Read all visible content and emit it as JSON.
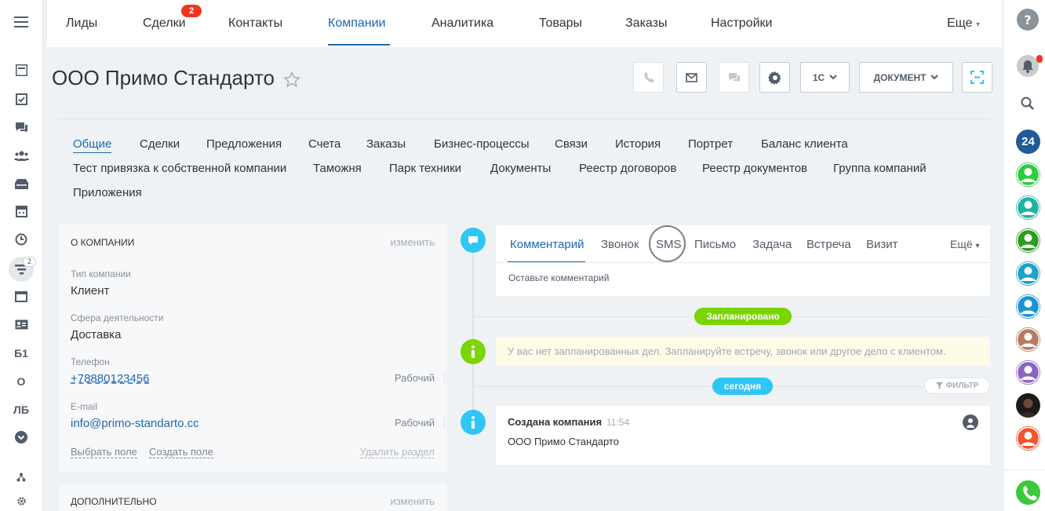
{
  "topnav": {
    "items": [
      "Лиды",
      "Сделки",
      "Контакты",
      "Компании",
      "Аналитика",
      "Товары",
      "Заказы",
      "Настройки"
    ],
    "deals_badge": "2",
    "more": "Еще"
  },
  "left_sidebar": {
    "badge": "2",
    "text_items": [
      "Б1",
      "О",
      "ЛБ"
    ]
  },
  "header": {
    "title": "ООО Примо Стандарто",
    "btn_1c": "1С",
    "btn_document": "ДОКУМЕНТ"
  },
  "tabs": {
    "row1": [
      "Общие",
      "Сделки",
      "Предложения",
      "Счета",
      "Заказы",
      "Бизнес-процессы",
      "Связи",
      "История",
      "Портрет",
      "Баланс клиента"
    ],
    "row2": [
      "Тест привязка к собственной компании",
      "Таможня",
      "Парк техники",
      "Документы",
      "Реестр договоров",
      "Реестр документов",
      "Группа компаний"
    ],
    "row3": [
      "Приложения"
    ]
  },
  "about": {
    "title": "О компании",
    "edit": "изменить",
    "fields": [
      {
        "label": "Тип компании",
        "value": "Клиент"
      },
      {
        "label": "Сфера деятельности",
        "value": "Доставка"
      },
      {
        "label": "Телефон",
        "value": "+78880123456",
        "type": "Рабочий"
      },
      {
        "label": "E-mail",
        "value": "info@primo-standarto.cc",
        "type": "Рабочий"
      }
    ],
    "select_field": "Выбрать поле",
    "create_field": "Создать поле",
    "delete_section": "Удалить раздел"
  },
  "extra": {
    "title": "Дополнительно",
    "edit": "изменить"
  },
  "composer": {
    "tabs": [
      "Комментарий",
      "Звонок",
      "SMS",
      "Письмо",
      "Задача",
      "Встреча",
      "Визит"
    ],
    "more": "Ещё",
    "placeholder": "Оставьте комментарий"
  },
  "timeline": {
    "planned": "Запланировано",
    "notice": "У вас нет запланированных дел. Запланируйте встречу, звонок или другое дело с клиентом.",
    "today": "сегодня",
    "filter": "ФИЛЬТР",
    "event_title": "Создана компания",
    "event_time": "11:54",
    "event_text": "ООО Примо Стандарто"
  },
  "right_sidebar": {
    "b24": "24"
  },
  "colors": {
    "accent": "#2067b0",
    "green": "#7bd500",
    "cyan": "#2fc6f6",
    "badge_red": "#f0371b"
  }
}
